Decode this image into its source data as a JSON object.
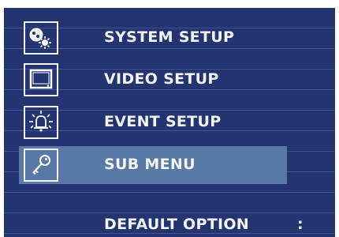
{
  "menu": {
    "items": [
      {
        "label": "SYSTEM SETUP",
        "icon": "system-setup-icon",
        "selected": false
      },
      {
        "label": "VIDEO SETUP",
        "icon": "monitor-icon",
        "selected": false
      },
      {
        "label": "EVENT SETUP",
        "icon": "alarm-bell-icon",
        "selected": false
      },
      {
        "label": "SUB MENU",
        "icon": "key-icon",
        "selected": true
      }
    ],
    "default_option": {
      "label": "DEFAULT OPTION",
      "separator": ":"
    }
  },
  "colors": {
    "background": "#243471",
    "highlight": "#5878a6",
    "text": "#f4f4f4"
  }
}
